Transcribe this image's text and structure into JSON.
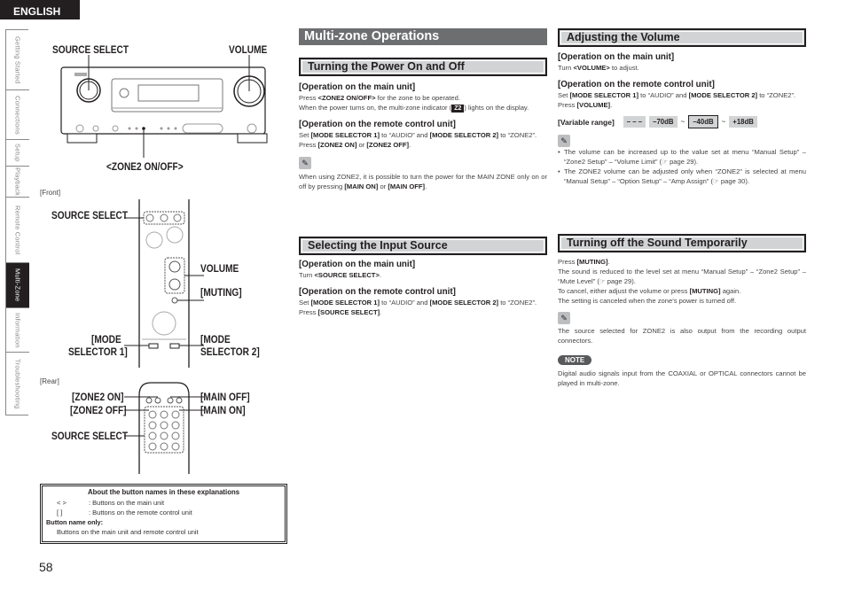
{
  "header": {
    "language": "ENGLISH"
  },
  "side_tabs": [
    {
      "label": "Getting Started",
      "active": false
    },
    {
      "label": "Connections",
      "active": false
    },
    {
      "label": "Setup",
      "active": false
    },
    {
      "label": "Playback",
      "active": false
    },
    {
      "label": "Remote Control",
      "active": false
    },
    {
      "label": "Multi-Zone",
      "active": true
    },
    {
      "label": "Information",
      "active": false
    },
    {
      "label": "Troubleshooting",
      "active": false
    }
  ],
  "illustrations": {
    "main_unit": {
      "source_select": "SOURCE SELECT",
      "volume": "VOLUME",
      "zone2_on_off": "<ZONE2 ON/OFF>"
    },
    "remote_front": {
      "caption": "[Front]",
      "source_select": "SOURCE SELECT",
      "volume": "VOLUME",
      "muting": "[MUTING]",
      "mode_selector_1_line1": "[MODE",
      "mode_selector_1_line2": "SELECTOR 1]",
      "mode_selector_2_line1": "[MODE",
      "mode_selector_2_line2": "SELECTOR 2]"
    },
    "remote_rear": {
      "caption": "[Rear]",
      "zone2_on": "[ZONE2 ON]",
      "zone2_off": "[ZONE2 OFF]",
      "main_off": "[MAIN OFF]",
      "main_on": "[MAIN ON]",
      "source_select": "SOURCE SELECT"
    }
  },
  "info_box": {
    "title": "About the button names in these explanations",
    "rows": [
      {
        "symbol": "<    >",
        "text": ": Buttons on the main unit"
      },
      {
        "symbol": "[    ]",
        "text": ": Buttons on the remote control unit"
      }
    ],
    "subhead": "Button name only:",
    "subtext": "Buttons on the main unit and remote control unit"
  },
  "page_number": "58",
  "main_title": "Multi-zone Operations",
  "sections": {
    "power": {
      "title": "Turning the Power On and Off",
      "main_unit_head": "[Operation on the main unit]",
      "main_unit_l1_pre": "Press ",
      "main_unit_l1_bold": "<ZONE2 ON/OFF>",
      "main_unit_l1_post": " for the zone to be operated.",
      "main_unit_l2_pre": "When the power turns on, the multi-zone indicator (",
      "indicator": "Z2",
      "main_unit_l2_post": ") lights on the display.",
      "remote_head": "[Operation on the remote control unit]",
      "remote_set": {
        "pre": "Set ",
        "b1": "[MODE SELECTOR 1]",
        "mid": " to “AUDIO” and ",
        "b2": "[MODE SELECTOR 2]",
        "post": " to “ZONE2”."
      },
      "remote_press": {
        "pre": "Press ",
        "b1": "[ZONE2 ON]",
        "mid": " or ",
        "b2": "[ZONE2 OFF]",
        "post": "."
      },
      "memo": {
        "pre": "When using ZONE2, it is possible to turn the power for the MAIN ZONE only on or off by pressing ",
        "b1": "[MAIN ON]",
        "mid": " or ",
        "b2": "[MAIN OFF]",
        "post": "."
      }
    },
    "input": {
      "title": "Selecting the Input Source",
      "main_unit_head": "[Operation on the main unit]",
      "main_unit_pre": "Turn ",
      "main_unit_bold": "<SOURCE SELECT>",
      "main_unit_post": ".",
      "remote_head": "[Operation on the remote control unit]",
      "remote_set": {
        "pre": "Set ",
        "b1": "[MODE SELECTOR 1]",
        "mid": " to “AUDIO” and ",
        "b2": "[MODE SELECTOR 2]",
        "post": " to “ZONE2”."
      },
      "remote_press": {
        "pre": "Press ",
        "b1": "[SOURCE SELECT]",
        "post": "."
      }
    },
    "volume": {
      "title": "Adjusting the Volume",
      "main_unit_head": "[Operation on the main unit]",
      "main_unit_pre": "Turn ",
      "main_unit_bold": "<VOLUME>",
      "main_unit_post": " to adjust.",
      "remote_head": "[Operation on the remote control unit]",
      "remote_set": {
        "pre": "Set ",
        "b1": "[MODE SELECTOR 1]",
        "mid": " to “AUDIO” and ",
        "b2": "[MODE SELECTOR 2]",
        "post": " to “ZONE2”."
      },
      "remote_press": {
        "pre": "Press ",
        "b1": "[VOLUME]",
        "post": "."
      },
      "range_label": "[Variable range]",
      "range_values": [
        "– – –",
        "–70dB",
        "–40dB",
        "+18dB"
      ],
      "range_sep": "~",
      "range_default": "–40dB",
      "notes": [
        "The volume can be increased up to the value set at menu “Manual Setup” – “Zone2 Setup” – “Volume Limit” (☞ page 29).",
        "The ZONE2 volume can be adjusted only when “ZONE2” is selected at menu “Manual Setup” – “Option Setup” – “Amp Assign” (☞ page 30)."
      ]
    },
    "mute": {
      "title": "Turning off the Sound Temporarily",
      "press": {
        "pre": "Press ",
        "b1": "[MUTING]",
        "post": "."
      },
      "line2": "The sound is reduced to the level set at menu “Manual Setup” – “Zone2 Setup” – “Mute Level” (☞ page 29).",
      "cancel": {
        "pre": "To cancel, either adjust the volume or press ",
        "b1": "[MUTING]",
        "post": " again."
      },
      "line4": "The setting is canceled when the zone’s power is turned off.",
      "memo": "The source selected for ZONE2 is also output from the recording output connectors.",
      "note_label": "NOTE",
      "note_text": "Digital audio signals input from the COAXIAL or OPTICAL connectors cannot be played in multi-zone."
    }
  }
}
